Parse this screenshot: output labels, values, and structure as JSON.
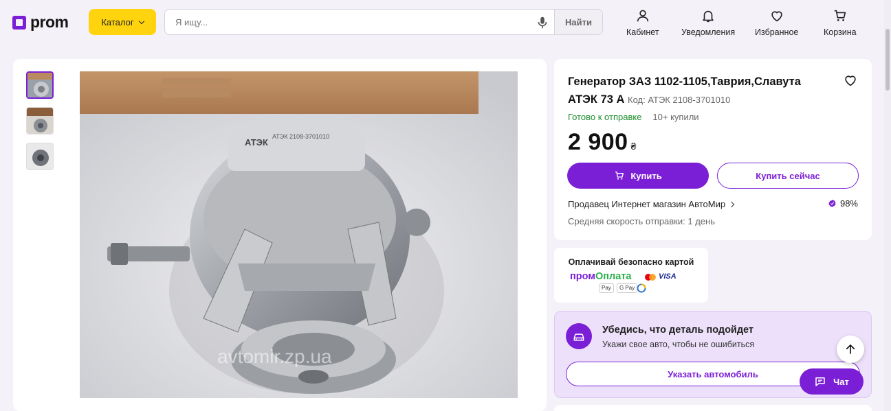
{
  "header": {
    "logo_text": "prom",
    "catalog_label": "Каталог",
    "search_placeholder": "Я ищу...",
    "search_button": "Найти",
    "nav": [
      {
        "label": "Кабинет",
        "icon": "user-icon"
      },
      {
        "label": "Уведомления",
        "icon": "bell-icon"
      },
      {
        "label": "Избранное",
        "icon": "heart-icon"
      },
      {
        "label": "Корзина",
        "icon": "cart-icon"
      }
    ]
  },
  "gallery": {
    "thumbnails": [
      "alternator-thumb-1",
      "alternator-thumb-2",
      "alternator-thumb-3"
    ],
    "active_index": 0,
    "watermark": "avtomir.zp.ua",
    "label_brand": "АТЭК",
    "label_line": "АТЭК 2108-3701010"
  },
  "product": {
    "title": "Генератор ЗАЗ 1102-1105,Таврия,Славута АТЭК 73 А",
    "code": "Код: АТЭК 2108-3701010",
    "status": "Готово к отправке",
    "bought": "10+ купили",
    "price": "2 900",
    "currency": "₴",
    "buy_label": "Купить",
    "buy_now_label": "Купить сейчас",
    "seller": "Продавец Интернет магазин АвтоМир",
    "rating": "98%",
    "speed": "Средняя скорость отправки: 1 день"
  },
  "payment": {
    "title": "Оплачивай безопасно картой",
    "brand_part1": "пром",
    "brand_part2": "Оплата",
    "visa": "VISA",
    "badges": [
      "Pay",
      "G Pay"
    ]
  },
  "fit": {
    "title": "Убедись, что деталь подойдет",
    "subtitle": "Укажи свое авто, чтобы не ошибиться",
    "button": "Указать автомобиль"
  },
  "chat": {
    "label": "Чат"
  },
  "colors": {
    "accent": "#7b1fd6",
    "catalog": "#ffd30d",
    "ready": "#1b8e2d"
  }
}
